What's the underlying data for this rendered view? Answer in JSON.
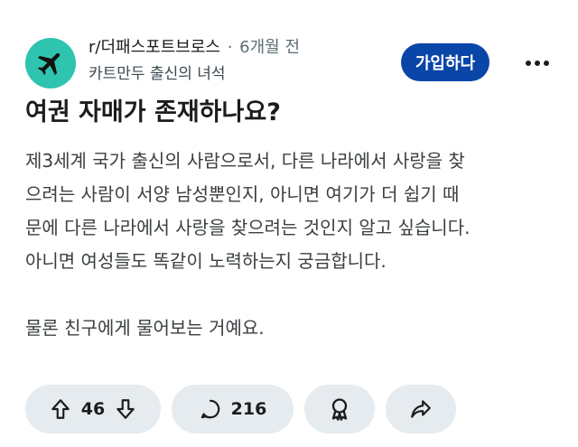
{
  "post": {
    "subreddit": "r/더패스포트브로스",
    "separator": "·",
    "time": "6개월 전",
    "author": "카트만두 출신의 녀석",
    "join_label": "가입하다",
    "title": "여권 자매가 존재하나요?",
    "body_lines": [
      "제3세계 국가 출신의 사람으로서, 다른 나라에서 사랑을 찾",
      "으려는 사람이 서양 남성뿐인지, 아니면 여기가 더 쉽기 때",
      "문에 다른 나라에서 사랑을 찾으려는 것인지 알고 싶습니다.",
      "아니면 여성들도 똑같이 노력하는지 궁금합니다.",
      "",
      "물론 친구에게 물어보는 거예요."
    ]
  },
  "actions": {
    "upvotes": "46",
    "comments": "216"
  },
  "icons": {
    "avatar": "airplane-icon",
    "more": "more-dots-icon",
    "upvote": "arrow-up-icon",
    "downvote": "arrow-down-icon",
    "comment": "comment-bubble-icon",
    "award": "award-icon",
    "share": "share-arrow-icon"
  },
  "colors": {
    "avatar_bg": "#2ec4b0",
    "join_button": "#0a45a8",
    "pill_bg": "#e5ebee"
  }
}
